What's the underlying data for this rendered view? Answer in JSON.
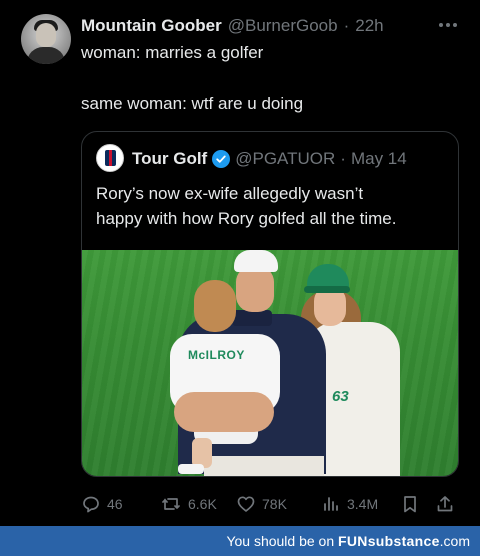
{
  "tweet": {
    "author_name": "Mountain Goober",
    "author_handle": "@BurnerGoob",
    "separator": "·",
    "time": "22h",
    "text_line1": "woman: marries a golfer",
    "text_line2": "same woman: wtf are u doing"
  },
  "quote": {
    "author_name": "Tour Golf",
    "author_handle": "@PGATUOR",
    "separator": "·",
    "date": "May 14",
    "text_line1": "Rory’s now ex-wife allegedly wasn’t",
    "text_line2": "happy with how Rory golfed all the time.",
    "photo_text_kid": "McILROY",
    "photo_text_caddie": "63"
  },
  "actions": {
    "replies": "46",
    "reposts": "6.6K",
    "likes": "78K",
    "views": "3.4M"
  },
  "icons": {
    "more": "more-horizontal-icon",
    "reply": "reply-icon",
    "repost": "repost-icon",
    "like": "heart-icon",
    "views": "views-bar-icon",
    "bookmark": "bookmark-icon",
    "share": "share-icon",
    "verified": "verified-badge-icon"
  },
  "footer": {
    "prefix": "You should be on",
    "brand": "FUNsubstance",
    "suffix": ".com"
  },
  "colors": {
    "background": "#000000",
    "text_primary": "#e7e9ea",
    "text_secondary": "#71767b",
    "verified_blue": "#1d9bf0",
    "footer_bar": "#2a63a8"
  }
}
